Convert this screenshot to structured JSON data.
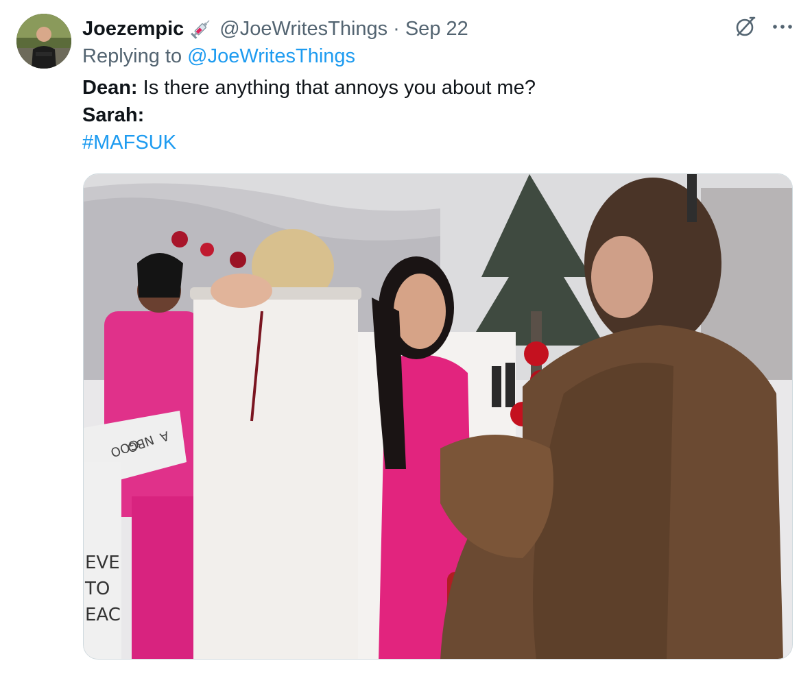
{
  "author": {
    "display_name": "Joezempic",
    "badge_icon": "syringe-icon",
    "handle": "@JoeWritesThings",
    "separator": "·",
    "date": "Sep 22",
    "avatar_icon": "avatar"
  },
  "reply": {
    "prefix": "Replying to",
    "handle": "@JoeWritesThings"
  },
  "content": {
    "line1_speaker": "Dean:",
    "line1_text": " Is there anything that annoys you about me?",
    "line2_speaker": "Sarah:",
    "hashtag": "#MAFSUK"
  },
  "toolbar": {
    "grok_icon": "grok-icon",
    "more_icon": "more-icon"
  },
  "media": {
    "banner_text": [
      "EVE",
      "TO",
      "EAC"
    ],
    "sleeve_text": [
      "GOO",
      "NBO",
      "A"
    ]
  },
  "colors": {
    "link": "#1d9bf0",
    "muted": "#536471",
    "text": "#0f1419"
  }
}
